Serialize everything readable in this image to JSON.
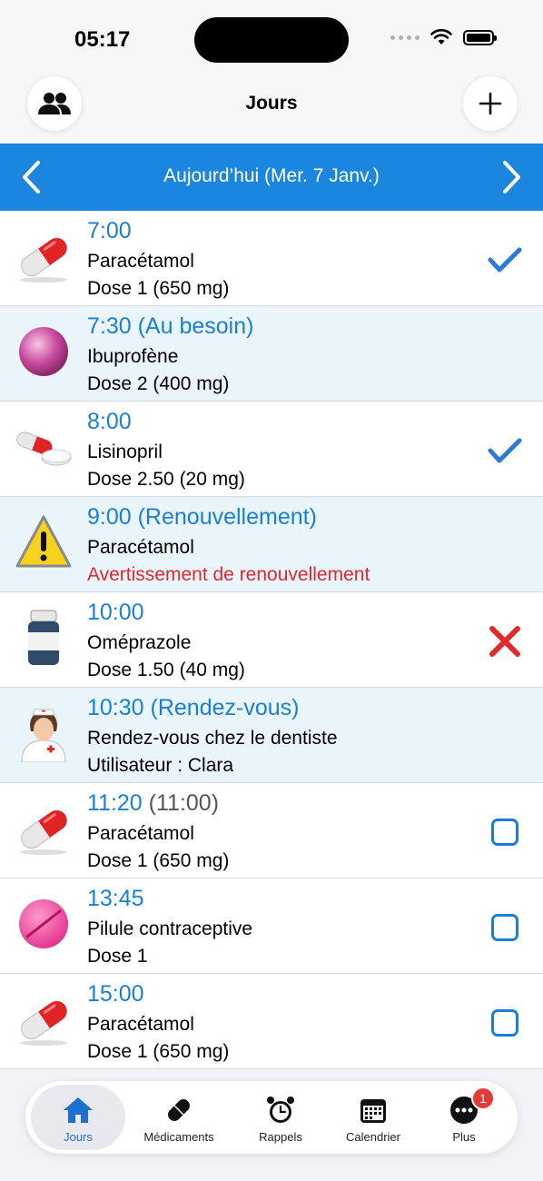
{
  "status_bar": {
    "time": "05:17"
  },
  "header": {
    "title": "Jours"
  },
  "date_bar": {
    "label": "Aujourd’hui (Mer. 7 Janv.)"
  },
  "entries": [
    {
      "time": "7:00",
      "time_extra": "",
      "name": "Paracétamol",
      "detail": "Dose 1 (650 mg)",
      "icon": "capsule-icon",
      "status": "taken"
    },
    {
      "time": "7:30 (Au besoin)",
      "time_extra": "",
      "name": "Ibuprofène",
      "detail": "Dose 2 (400 mg)",
      "icon": "pink-round-pill-icon",
      "status": "none"
    },
    {
      "time": "8:00",
      "time_extra": "",
      "name": "Lisinopril",
      "detail": "Dose 2.50 (20 mg)",
      "icon": "capsule-and-tablet-icon",
      "status": "taken"
    },
    {
      "time": "9:00 (Renouvellement)",
      "time_extra": "",
      "name": "Paracétamol",
      "detail": "Avertissement de renouvellement",
      "icon": "warning-icon",
      "status": "none"
    },
    {
      "time": "10:00",
      "time_extra": "",
      "name": "Oméprazole",
      "detail": "Dose 1.50 (40 mg)",
      "icon": "pill-bottle-icon",
      "status": "skipped"
    },
    {
      "time": "10:30 (Rendez-vous)",
      "time_extra": "",
      "name": "Rendez-vous chez le dentiste",
      "detail": "Utilisateur : Clara",
      "icon": "nurse-icon",
      "status": "none"
    },
    {
      "time": "11:20",
      "time_extra": " (11:00)",
      "name": "Paracétamol",
      "detail": "Dose 1 (650 mg)",
      "icon": "capsule-icon",
      "status": "pending"
    },
    {
      "time": "13:45",
      "time_extra": "",
      "name": "Pilule contraceptive",
      "detail": "Dose 1",
      "icon": "pink-tablet-icon",
      "status": "pending"
    },
    {
      "time": "15:00",
      "time_extra": "",
      "name": "Paracétamol",
      "detail": "Dose 1 (650 mg)",
      "icon": "capsule-icon",
      "status": "pending"
    }
  ],
  "tabs": [
    {
      "label": "Jours",
      "icon": "home-icon",
      "active": true
    },
    {
      "label": "Médicaments",
      "icon": "pill-icon",
      "active": false
    },
    {
      "label": "Rappels",
      "icon": "alarm-clock-icon",
      "active": false
    },
    {
      "label": "Calendrier",
      "icon": "calendar-icon",
      "active": false
    },
    {
      "label": "Plus",
      "icon": "more-icon",
      "active": false,
      "badge": "1"
    }
  ],
  "colors": {
    "accent": "#1a86de",
    "warning_text": "#e0282e",
    "check": "#2a7bd6",
    "cross": "#e02b2b"
  }
}
